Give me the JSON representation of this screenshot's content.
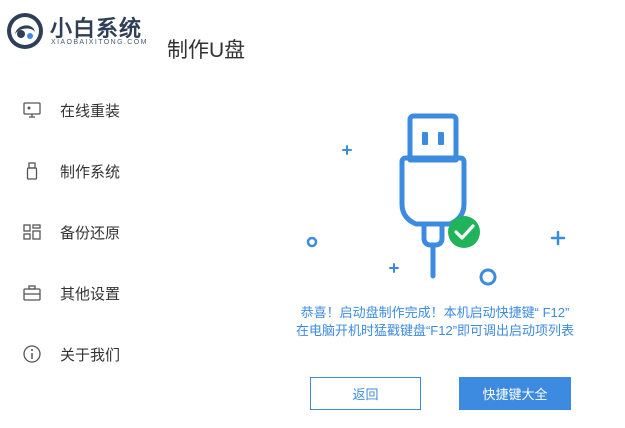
{
  "brand": {
    "name": "小白系统",
    "subtitle": "XIAOBAIXITONG.COM"
  },
  "page": {
    "title": "制作U盘"
  },
  "sidebar": {
    "items": [
      {
        "label": "在线重装",
        "icon": "monitor-icon"
      },
      {
        "label": "制作系统",
        "icon": "usb-drive-icon"
      },
      {
        "label": "备份还原",
        "icon": "grid-icon"
      },
      {
        "label": "其他设置",
        "icon": "briefcase-icon"
      },
      {
        "label": "关于我们",
        "icon": "info-icon"
      }
    ]
  },
  "message": {
    "line1": "恭喜！启动盘制作完成！本机启动快捷键“ F12”",
    "line2": "在电脑开机时猛戳键盘“F12”即可调出启动项列表"
  },
  "buttons": {
    "back_label": "返回",
    "shortcut_label": "快捷键大全"
  },
  "colors": {
    "accent": "#3d8be0",
    "success": "#21b35a",
    "brand_text": "#2f3f57"
  }
}
